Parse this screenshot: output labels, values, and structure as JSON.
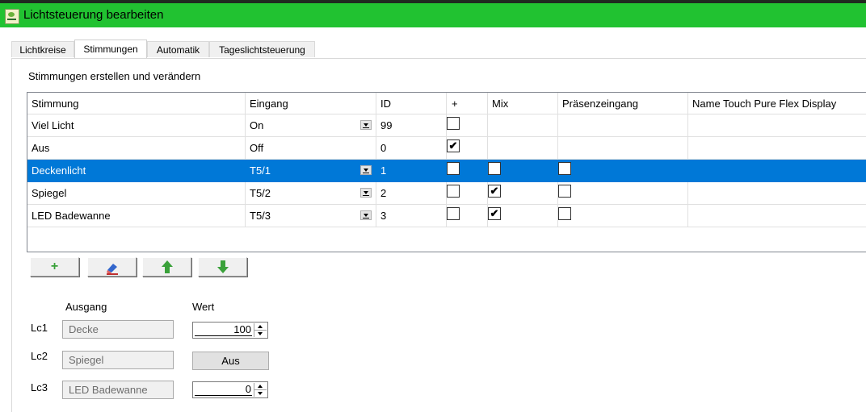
{
  "window": {
    "title": "Lichtsteuerung bearbeiten"
  },
  "tabs": [
    "Lichtkreise",
    "Stimmungen",
    "Automatik",
    "Tageslichtsteuerung"
  ],
  "active_tab": "Stimmungen",
  "section_title": "Stimmungen erstellen und verändern",
  "grid": {
    "columns": [
      "Stimmung",
      "Eingang",
      "ID",
      "+",
      "Mix",
      "Präsenzeingang",
      "Name Touch Pure Flex Display"
    ],
    "rows": [
      {
        "stimmung": "Viel Licht",
        "eingang": "On",
        "eingang_dropdown": true,
        "id": "99",
        "plus": false,
        "mix": null,
        "praesenz": null,
        "selected": false
      },
      {
        "stimmung": "Aus",
        "eingang": "Off",
        "eingang_dropdown": false,
        "id": "0",
        "plus": true,
        "mix": null,
        "praesenz": null,
        "selected": false
      },
      {
        "stimmung": "Deckenlicht",
        "eingang": "T5/1",
        "eingang_dropdown": true,
        "id": "1",
        "plus": false,
        "mix": false,
        "praesenz": false,
        "selected": true
      },
      {
        "stimmung": "Spiegel",
        "eingang": "T5/2",
        "eingang_dropdown": true,
        "id": "2",
        "plus": false,
        "mix": true,
        "praesenz": false,
        "selected": false
      },
      {
        "stimmung": "LED Badewanne",
        "eingang": "T5/3",
        "eingang_dropdown": true,
        "id": "3",
        "plus": false,
        "mix": true,
        "praesenz": false,
        "selected": false
      }
    ]
  },
  "toolbar": {
    "icons": [
      "plus-icon",
      "eraser-icon",
      "arrow-up-icon",
      "arrow-down-icon"
    ]
  },
  "outputs": {
    "header_ausgang": "Ausgang",
    "header_wert": "Wert",
    "items": [
      {
        "id": "Lc1",
        "name": "Decke",
        "type": "spin",
        "value": "100"
      },
      {
        "id": "Lc2",
        "name": "Spiegel",
        "type": "button",
        "value": "Aus"
      },
      {
        "id": "Lc3",
        "name": "LED Badewanne",
        "type": "spin",
        "value": "0"
      }
    ]
  },
  "colors": {
    "titlebar": "#21c231",
    "selection": "#0078d7",
    "arrow_green": "#3aa13a"
  }
}
